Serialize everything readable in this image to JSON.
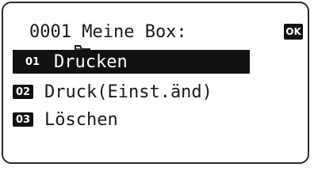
{
  "header": {
    "title": "0001 Meine Box:",
    "box_icon": "box-folder-icon",
    "nav_icon": "four-way-arrows-icon",
    "ok_label": "OK"
  },
  "menu": {
    "items": [
      {
        "number": "01",
        "label": "Drucken",
        "selected": true
      },
      {
        "number": "02",
        "label": "Druck(Einst.änd)",
        "selected": false
      },
      {
        "number": "03",
        "label": "Löschen",
        "selected": false
      }
    ]
  },
  "colors": {
    "background": "#ffffff",
    "text": "#1a1a1a",
    "highlight": "#111111",
    "highlight_text": "#ffffff"
  }
}
